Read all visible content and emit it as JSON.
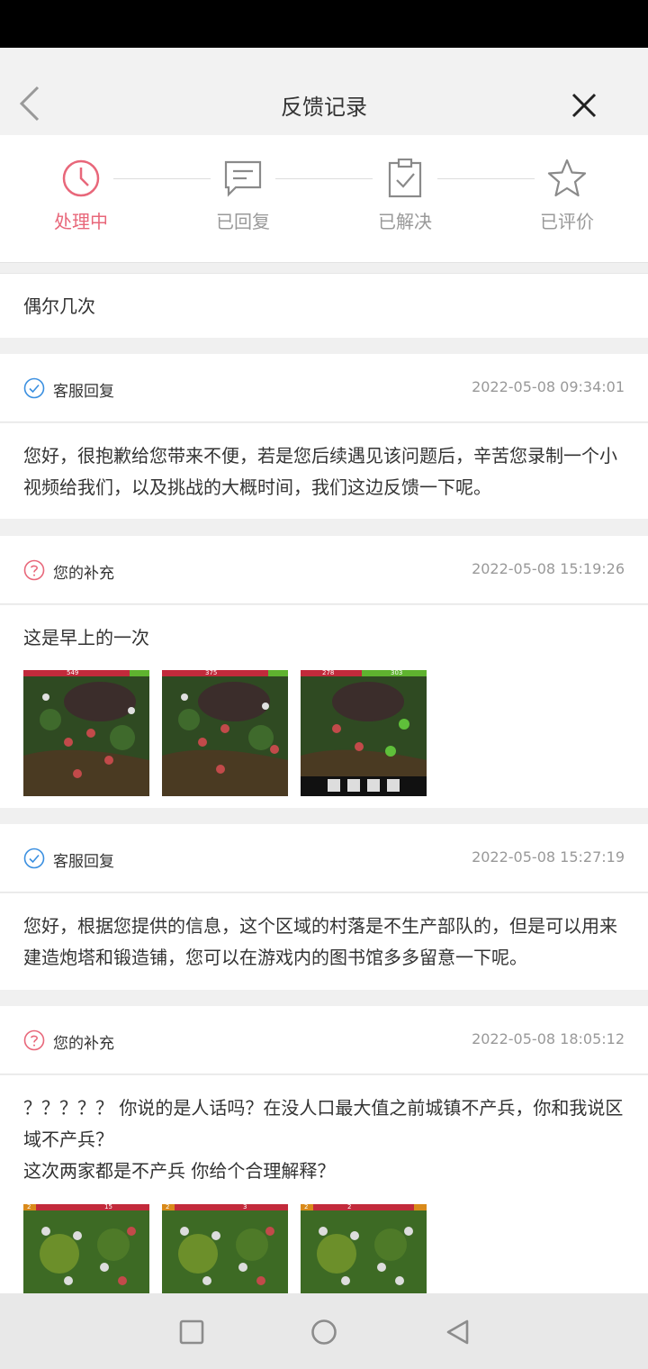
{
  "header": {
    "title": "反馈记录"
  },
  "steps": [
    {
      "label": "处理中",
      "icon": "clock-icon",
      "active": true
    },
    {
      "label": "已回复",
      "icon": "message-icon",
      "active": false
    },
    {
      "label": "已解决",
      "icon": "clipboard-check-icon",
      "active": false
    },
    {
      "label": "已评价",
      "icon": "star-icon",
      "active": false
    }
  ],
  "colors": {
    "accent": "#e8677a",
    "reply": "#3a8fe0",
    "supplement": "#e8677a"
  },
  "entries": [
    {
      "text": "偶尔几次"
    },
    {
      "author": "客服回复",
      "time": "2022-05-08 09:34:01",
      "text": "您好，很抱歉给您带来不便，若是您后续遇见该问题后，辛苦您录制一个小视频给我们，以及挑战的大概时间，我们这边反馈一下呢。"
    },
    {
      "author": "您的补充",
      "time": "2022-05-08 15:19:26",
      "text": "这是早上的一次"
    },
    {
      "author": "客服回复",
      "time": "2022-05-08 15:27:19",
      "text": "您好，根据您提供的信息，这个区域的村落是不生产部队的，但是可以用来建造炮塔和锻造铺，您可以在游戏内的图书馆多多留意一下呢。"
    },
    {
      "author": "您的补充",
      "time": "2022-05-08 18:05:12",
      "line1": "？？？？？ 你说的是人话吗？在没人口最大值之前城镇不产兵，你和我说区域不产兵？",
      "line2": "这次两家都是不产兵   你给个合理解释？"
    }
  ],
  "screenshots_a": [
    "549",
    "375",
    "278"
  ],
  "screenshots_a_right": [
    "",
    "",
    "303"
  ],
  "screenshots_b": [
    "2",
    "2",
    "2"
  ],
  "screenshots_b_right": [
    "15",
    "3",
    "2"
  ]
}
